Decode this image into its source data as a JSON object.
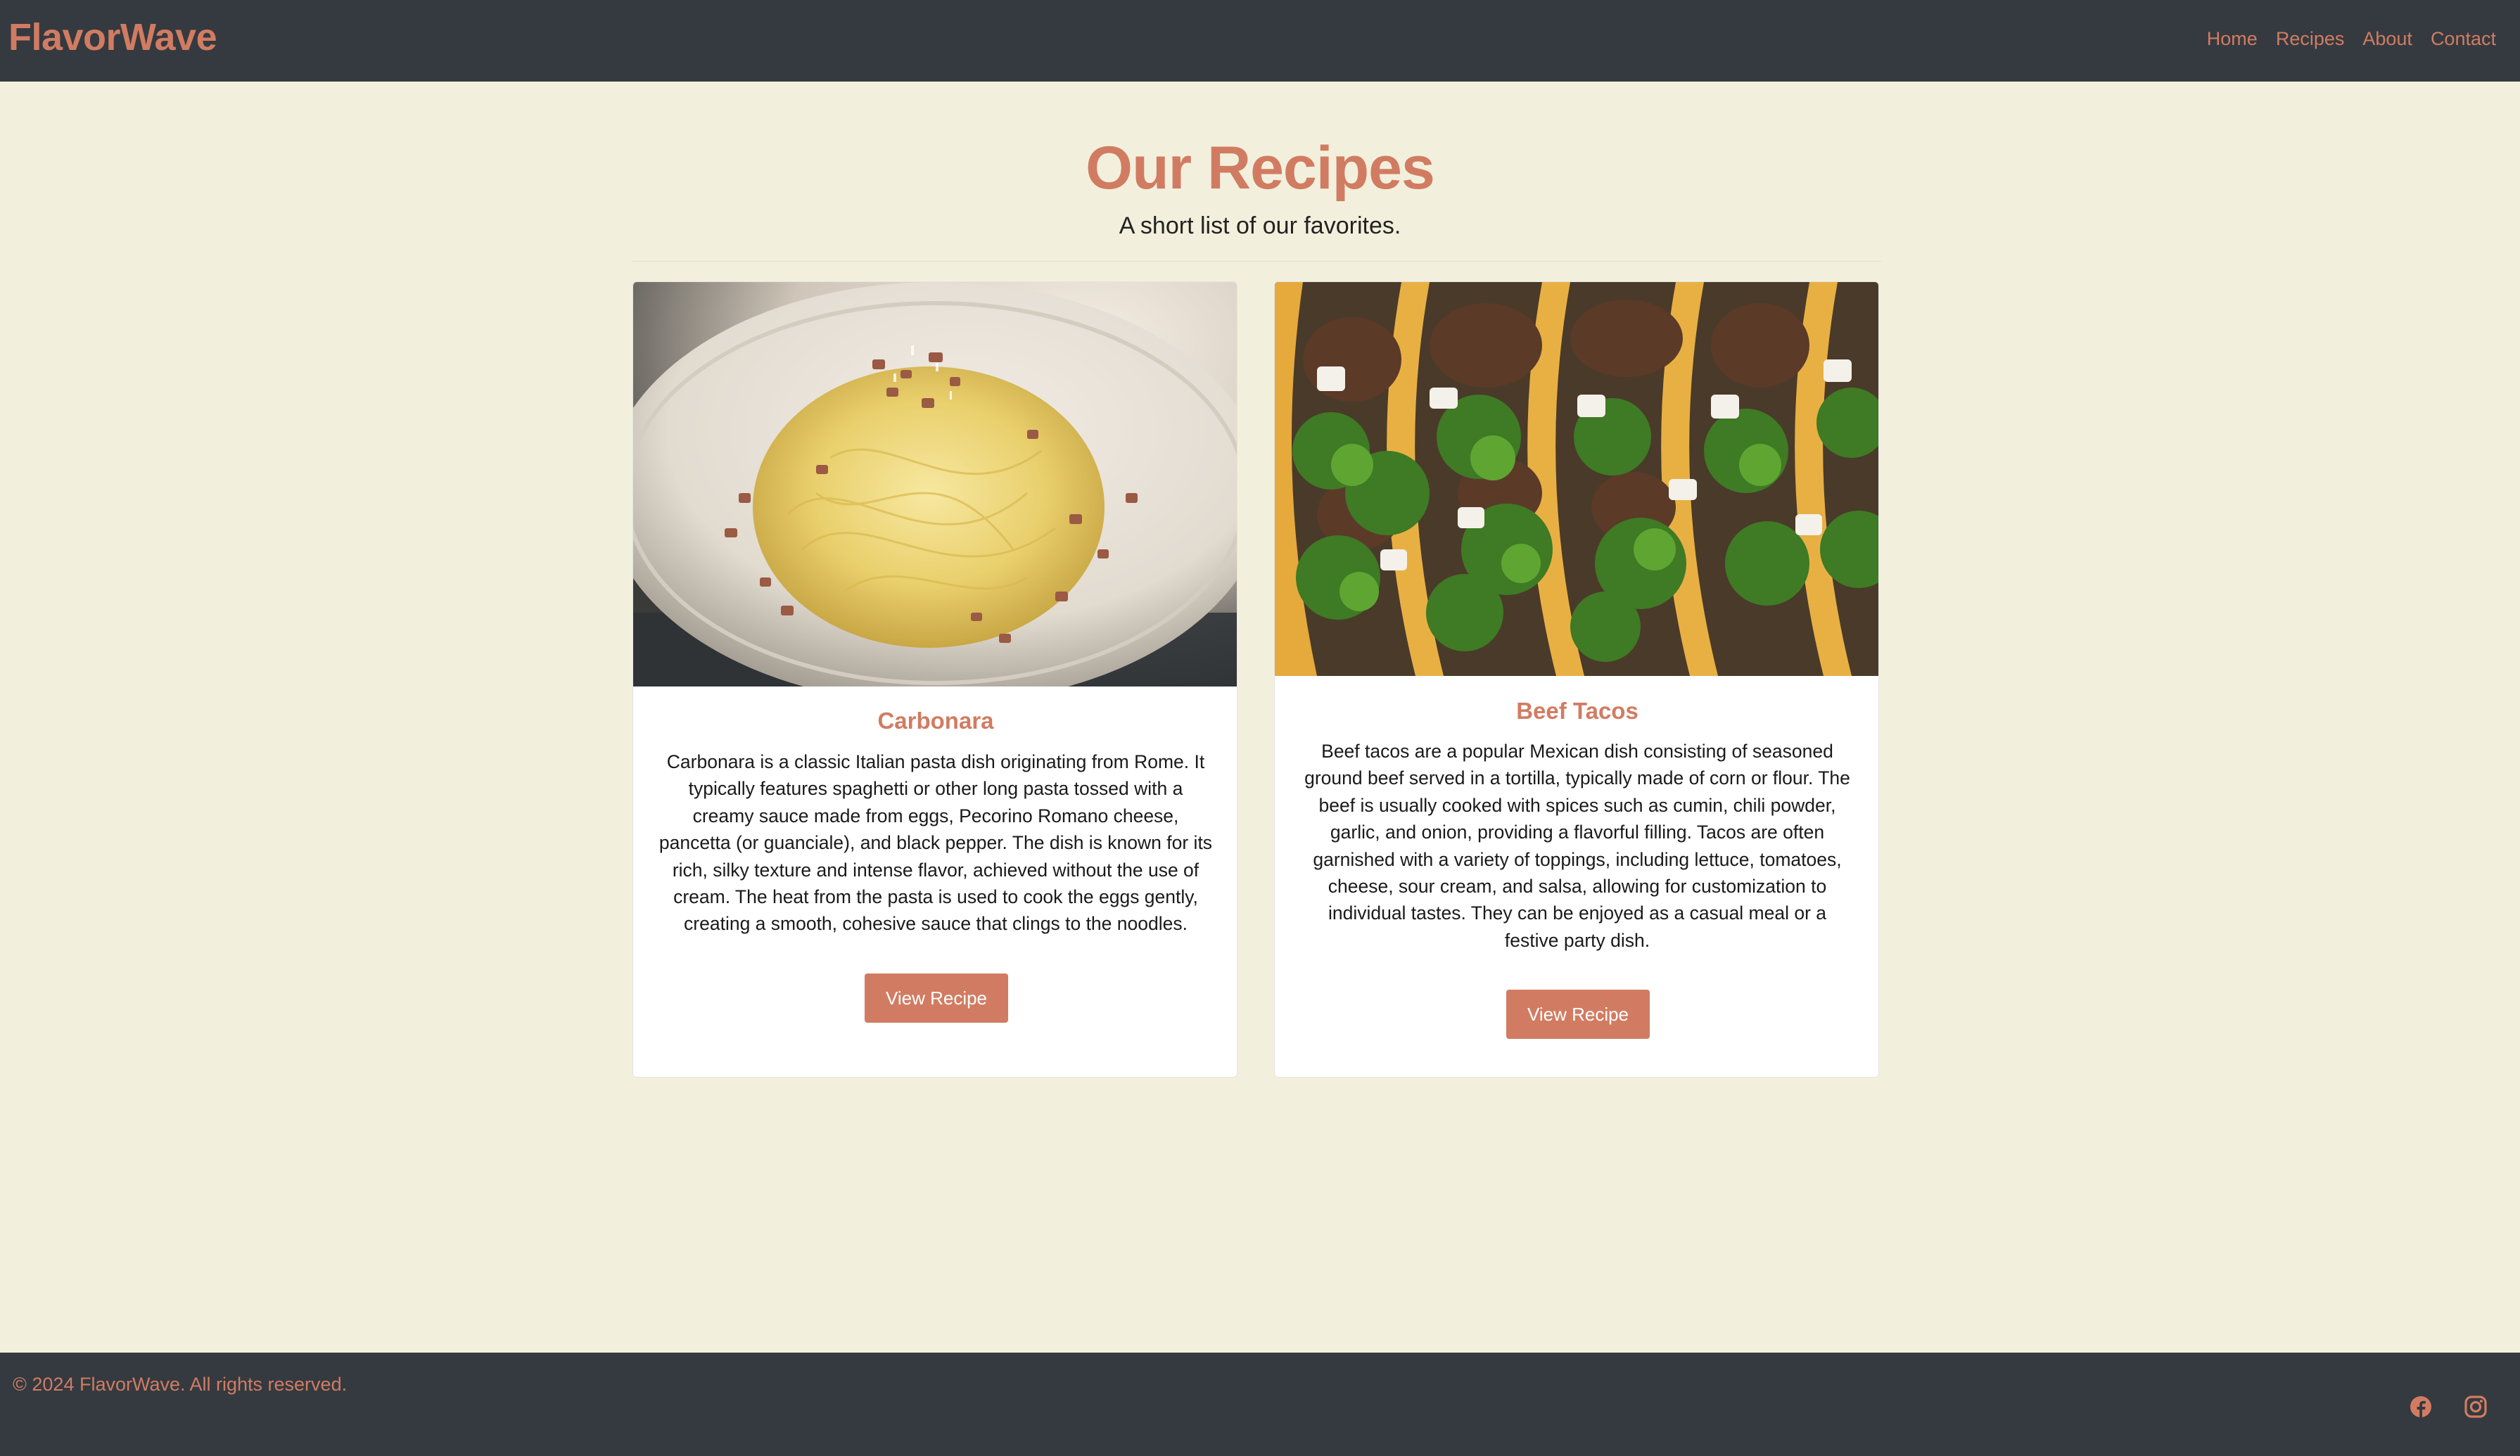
{
  "brand": "FlavorWave",
  "nav": {
    "items": [
      "Home",
      "Recipes",
      "About",
      "Contact"
    ]
  },
  "hero": {
    "title": "Our Recipes",
    "subtitle": "A short list of our favorites."
  },
  "recipes": [
    {
      "title": "Carbonara",
      "description": "Carbonara is a classic Italian pasta dish originating from Rome. It typically features spaghetti or other long pasta tossed with a creamy sauce made from eggs, Pecorino Romano cheese, pancetta (or guanciale), and black pepper. The dish is known for its rich, silky texture and intense flavor, achieved without the use of cream. The heat from the pasta is used to cook the eggs gently, creating a smooth, cohesive sauce that clings to the noodles.",
      "button": "View Recipe",
      "image_icon": "pasta-photo"
    },
    {
      "title": "Beef Tacos",
      "description": "Beef tacos are a popular Mexican dish consisting of seasoned ground beef served in a tortilla, typically made of corn or flour. The beef is usually cooked with spices such as cumin, chili powder, garlic, and onion, providing a flavorful filling. Tacos are often garnished with a variety of toppings, including lettuce, tomatoes, cheese, sour cream, and salsa, allowing for customization to individual tastes. They can be enjoyed as a casual meal or a festive party dish.",
      "button": "View Recipe",
      "image_icon": "tacos-photo"
    }
  ],
  "footer": {
    "copyright": "© 2024 FlavorWave. All rights reserved.",
    "social": [
      "facebook-icon",
      "instagram-icon"
    ]
  },
  "colors": {
    "accent": "#d17c62",
    "navbar": "#343a40",
    "page_bg": "#f2f0dc"
  }
}
